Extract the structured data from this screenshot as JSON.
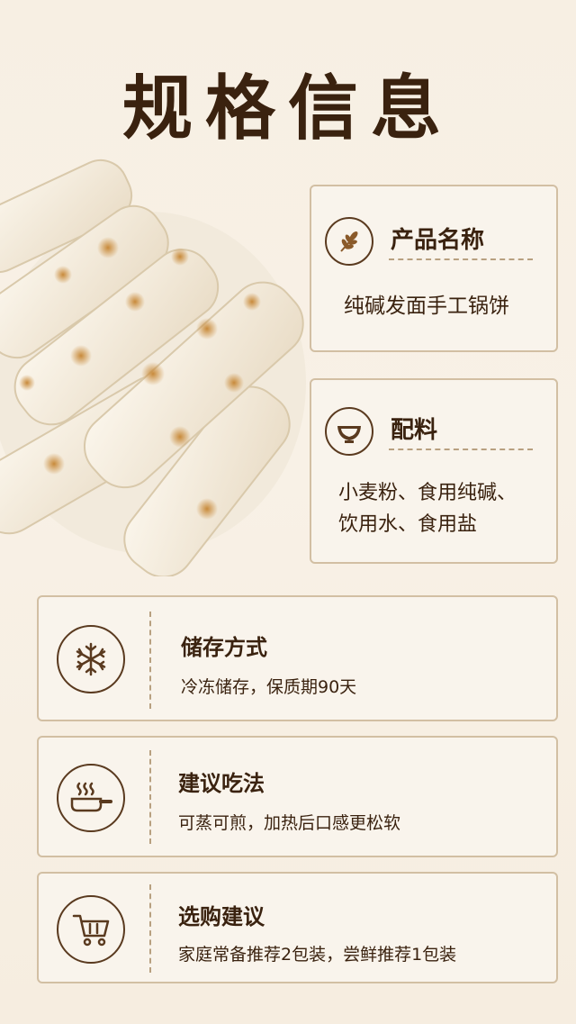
{
  "page_title": "规格信息",
  "product_name": {
    "label": "产品名称",
    "icon": "wheat-icon",
    "value": "纯碱发面手工锅饼"
  },
  "ingredients": {
    "label": "配料",
    "icon": "bowl-icon",
    "line1": "小麦粉、食用纯碱、",
    "line2": "饮用水、食用盐"
  },
  "storage": {
    "label": "储存方式",
    "icon": "snowflake-icon",
    "value": "冷冻储存，保质期90天"
  },
  "eating": {
    "label": "建议吃法",
    "icon": "frying-pan-icon",
    "value": "可蒸可煎，加热后口感更松软"
  },
  "purchase": {
    "label": "选购建议",
    "icon": "shopping-cart-icon",
    "value": "家庭常备推荐2包装，尝鲜推荐1包装"
  },
  "colors": {
    "accent": "#3a220f",
    "border": "#d2bfa3",
    "card": "#f9f4ec"
  }
}
